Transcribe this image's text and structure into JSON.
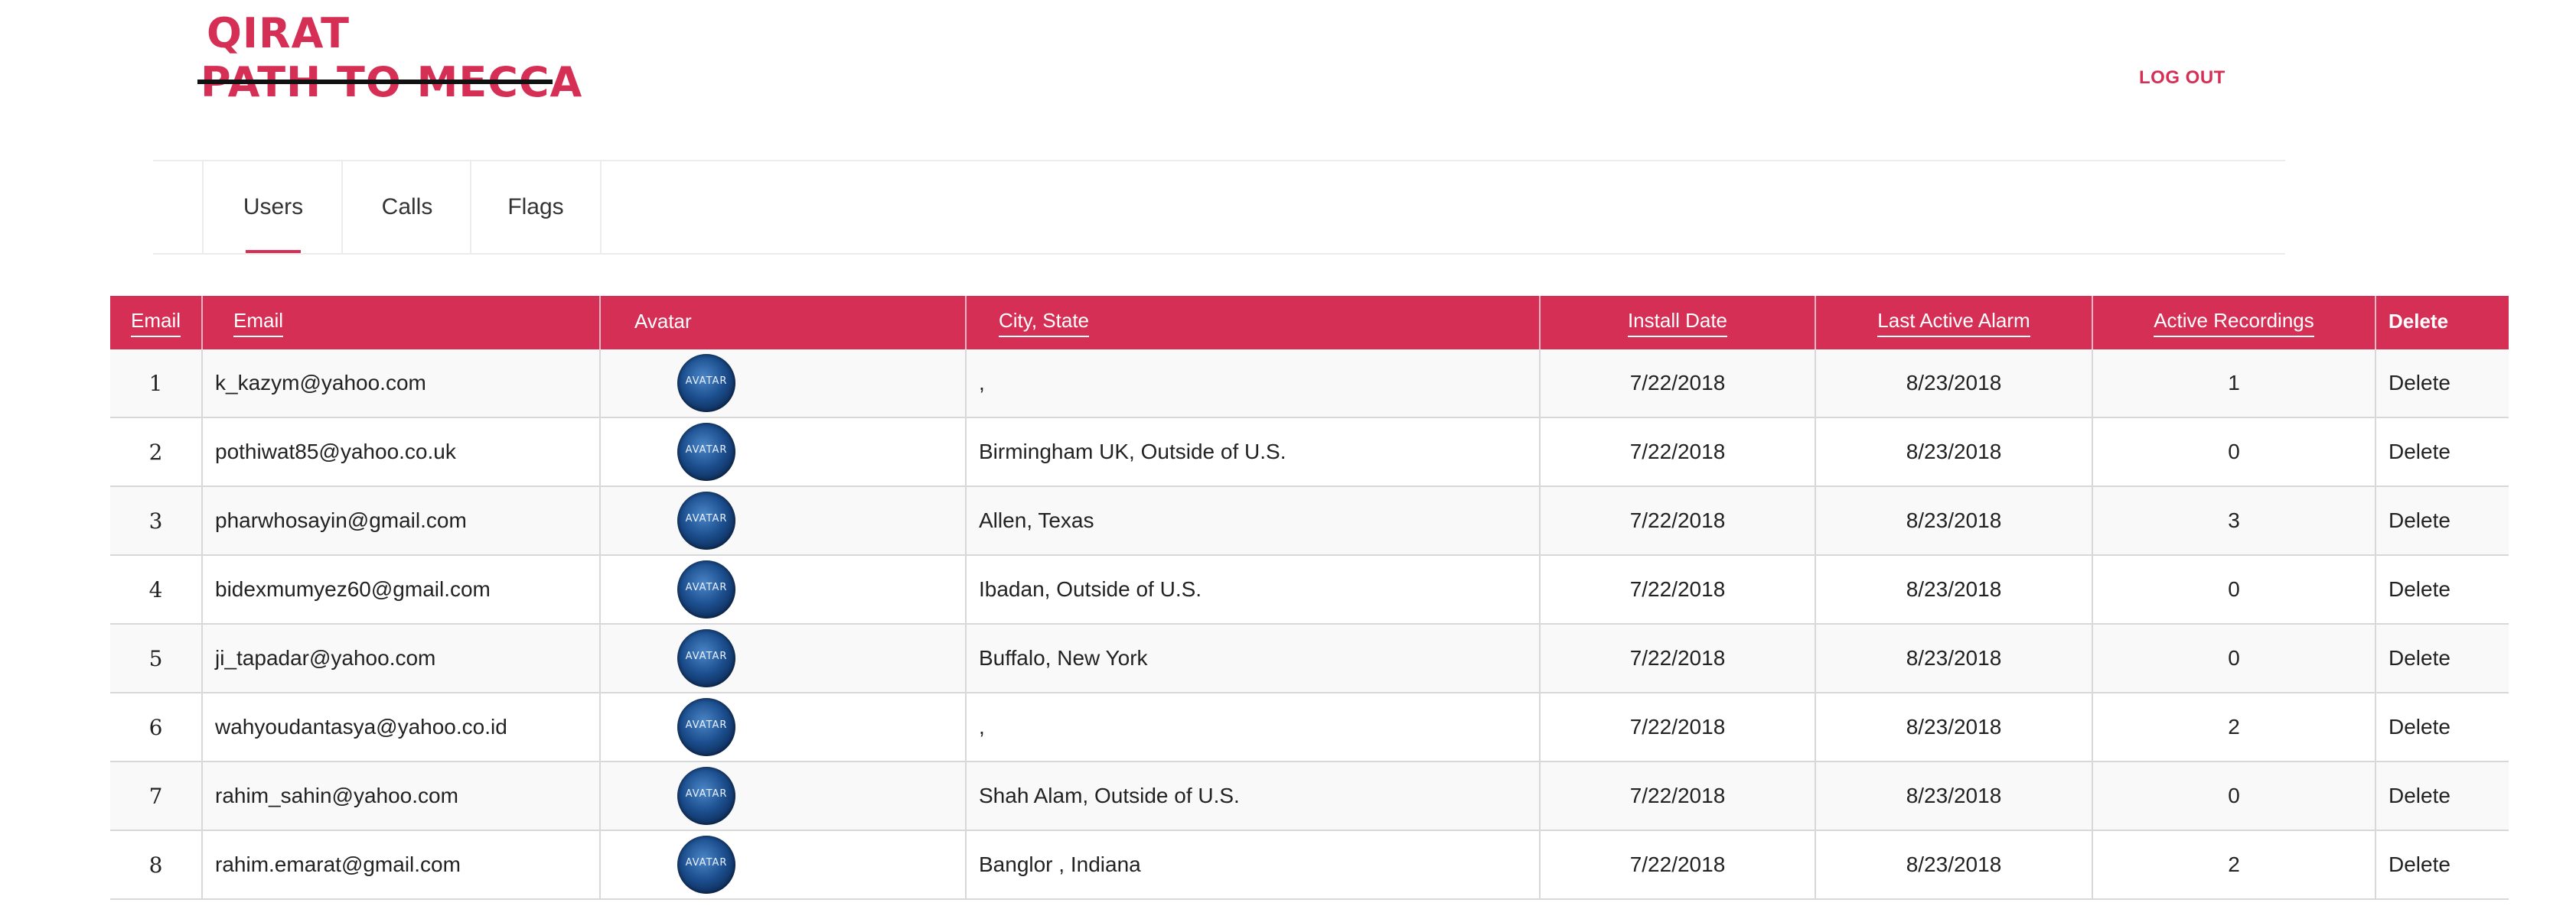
{
  "logo": {
    "line1": "QIRAT",
    "line2": "PATH TO MECCA"
  },
  "header": {
    "logout": "LOG OUT"
  },
  "tabs": [
    {
      "label": "Users",
      "active": true
    },
    {
      "label": "Calls",
      "active": false
    },
    {
      "label": "Flags",
      "active": false
    }
  ],
  "table": {
    "columns": [
      "Email",
      "Email",
      "Avatar",
      "City, State",
      "Install Date",
      "Last Active Alarm",
      "Active Recordings",
      "Delete"
    ],
    "avatar_text": "AVATAR",
    "rows": [
      {
        "num": "1",
        "email": "k_kazym@yahoo.com",
        "city": ",",
        "install": "7/22/2018",
        "last": "8/23/2018",
        "rec": "1",
        "del": "Delete"
      },
      {
        "num": "2",
        "email": "pothiwat85@yahoo.co.uk",
        "city": "Birmingham UK, Outside of U.S.",
        "install": "7/22/2018",
        "last": "8/23/2018",
        "rec": "0",
        "del": "Delete"
      },
      {
        "num": "3",
        "email": "pharwhosayin@gmail.com",
        "city": "Allen, Texas",
        "install": "7/22/2018",
        "last": "8/23/2018",
        "rec": "3",
        "del": "Delete"
      },
      {
        "num": "4",
        "email": "bidexmumyez60@gmail.com",
        "city": "Ibadan, Outside of U.S.",
        "install": "7/22/2018",
        "last": "8/23/2018",
        "rec": "0",
        "del": "Delete"
      },
      {
        "num": "5",
        "email": "ji_tapadar@yahoo.com",
        "city": "Buffalo, New York",
        "install": "7/22/2018",
        "last": "8/23/2018",
        "rec": "0",
        "del": "Delete"
      },
      {
        "num": "6",
        "email": "wahyoudantasya@yahoo.co.id",
        "city": ",",
        "install": "7/22/2018",
        "last": "8/23/2018",
        "rec": "2",
        "del": "Delete"
      },
      {
        "num": "7",
        "email": "rahim_sahin@yahoo.com",
        "city": "Shah Alam, Outside of U.S.",
        "install": "7/22/2018",
        "last": "8/23/2018",
        "rec": "0",
        "del": "Delete"
      },
      {
        "num": "8",
        "email": "rahim.emarat@gmail.com",
        "city": "Banglor , Indiana",
        "install": "7/22/2018",
        "last": "8/23/2018",
        "rec": "2",
        "del": "Delete"
      }
    ]
  },
  "colors": {
    "accent": "#d62f55",
    "link": "#2255cc"
  }
}
